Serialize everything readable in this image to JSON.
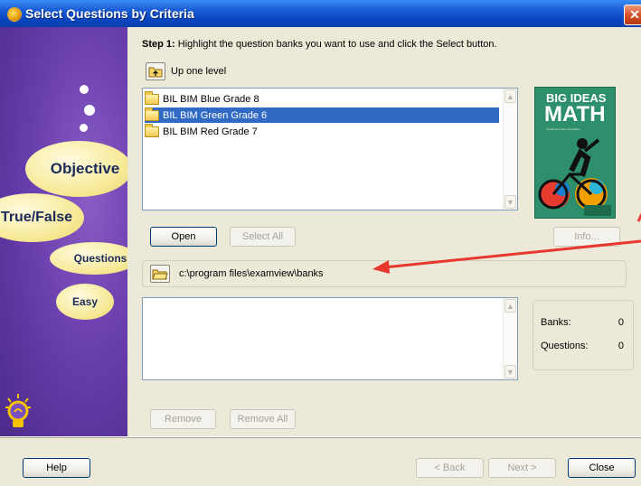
{
  "window": {
    "title": "Select Questions by Criteria"
  },
  "sidebar": {
    "bubbles": [
      "Objective",
      "True/False",
      "Questions",
      "Easy"
    ]
  },
  "step": {
    "label": "Step 1:",
    "text": "Highlight the question banks you want to use and click the Select button."
  },
  "up_level": {
    "label": "Up one level"
  },
  "banks": {
    "items": [
      {
        "label": "BIL BIM Blue Grade 8",
        "selected": false
      },
      {
        "label": "BIL BIM Green Grade 6",
        "selected": true
      },
      {
        "label": "BIL BIM Red Grade 7",
        "selected": false
      }
    ]
  },
  "book": {
    "line1": "BIG IDEAS",
    "line2": "MATH",
    "subtitle": "A Common Core Curriculum",
    "authors": "Ron Larson\nLaurie Boswell"
  },
  "buttons": {
    "open": "Open",
    "select_all": "Select All",
    "info": "Info...",
    "remove": "Remove",
    "remove_all": "Remove All",
    "help": "Help",
    "back": "< Back",
    "next": "Next >",
    "close": "Close"
  },
  "path": {
    "value": "c:\\program files\\examview\\banks"
  },
  "stats": {
    "banks_label": "Banks:",
    "banks_value": "0",
    "questions_label": "Questions:",
    "questions_value": "0"
  },
  "colors": {
    "title_bar": "#0a46c4",
    "selection": "#316ac5",
    "sidebar": "#6a3fae",
    "annotation_arrow": "#e8372e"
  }
}
